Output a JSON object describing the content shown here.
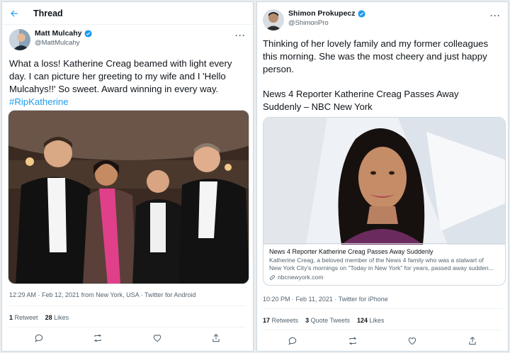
{
  "left": {
    "header": {
      "title": "Thread"
    },
    "author": {
      "name": "Matt Mulcahy",
      "handle": "@MattMulcahy"
    },
    "tweet": {
      "line1": "What a loss! Katherine Creag beamed with light every",
      "line2": "day. I can picture her greeting to my wife and I 'Hello",
      "line3": "Mulcahys!!' So sweet. Award winning in every way.",
      "hashtag": "#RipKatherine"
    },
    "meta": "12:29 AM · Feb 12, 2021 from New York, USA · Twitter for Android",
    "stats": {
      "retweets_count": "1",
      "retweets_label": "Retweet",
      "likes_count": "28",
      "likes_label": "Likes"
    },
    "icons": [
      "reply-icon",
      "retweet-icon",
      "like-icon",
      "share-icon"
    ]
  },
  "right": {
    "author": {
      "name": "Shimon Prokupecz",
      "handle": "@ShimonPro"
    },
    "tweet": {
      "line1": "Thinking of her lovely family and my former colleagues",
      "line2": "this morning. She was the most cheery and just happy",
      "line3": "person."
    },
    "article": {
      "line1": "News 4 Reporter Katherine Creag Passes Away",
      "line2": "Suddenly – NBC New York"
    },
    "card": {
      "title": "News 4 Reporter Katherine Creag Passes Away Suddenly",
      "desc1": "Katherine Creag, a beloved member of the News 4 family who was a stalwart of",
      "desc2": "New York City's mornings on \"Today in New York\" for years, passed away sudden...",
      "domain": "nbcnewyork.com"
    },
    "meta": "10:20 PM · Feb 11, 2021 · Twitter for iPhone",
    "stats": {
      "retweets_count": "17",
      "retweets_label": "Retweets",
      "quotes_count": "3",
      "quotes_label": "Quote Tweets",
      "likes_count": "124",
      "likes_label": "Likes"
    },
    "icons": [
      "reply-icon",
      "retweet-icon",
      "like-icon",
      "share-icon"
    ]
  },
  "colors": {
    "accent": "#1d9bf0",
    "secondary_text": "#536471",
    "border": "#cfd9de"
  }
}
